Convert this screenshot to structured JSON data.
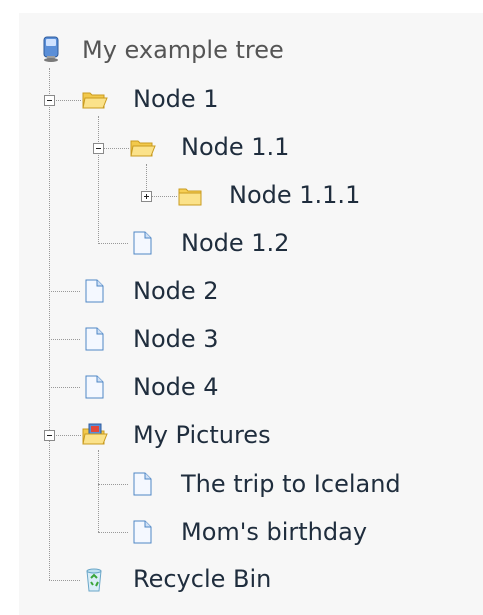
{
  "tree": {
    "root_label": "My example tree",
    "nodes": {
      "node_1": "Node 1",
      "node_1_1": "Node 1.1",
      "node_1_1_1": "Node 1.1.1",
      "node_1_2": "Node 1.2",
      "node_2": "Node 2",
      "node_3": "Node 3",
      "node_4": "Node 4",
      "my_pictures": "My Pictures",
      "trip": "The trip to Iceland",
      "birthday": "Mom's birthday",
      "recycle_bin": "Recycle Bin"
    }
  },
  "icons": {
    "root": "computer-icon",
    "folder": "folder-icon",
    "document": "document-icon",
    "pictures": "pictures-folder-icon",
    "recycle": "recycle-bin-icon"
  },
  "colors": {
    "folder": "#f7cf55",
    "document": "#4f87c6",
    "line": "#999999"
  }
}
